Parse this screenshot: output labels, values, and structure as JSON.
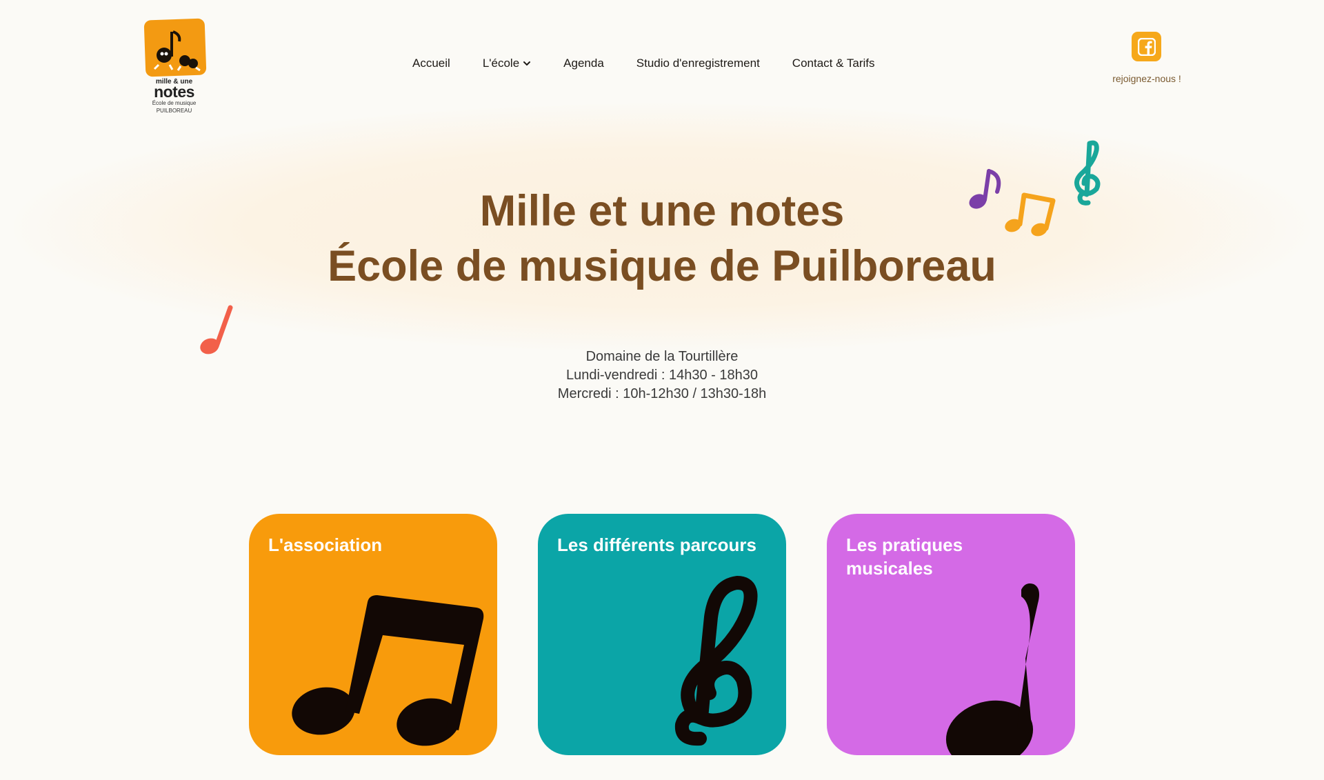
{
  "logo": {
    "line1": "mille & une",
    "line2": "notes",
    "line3": "École de musique",
    "line4": "PUILBOREAU",
    "color": "#f39a12"
  },
  "nav": {
    "items": [
      {
        "label": "Accueil"
      },
      {
        "label": "L'école",
        "has_dropdown": true
      },
      {
        "label": "Agenda"
      },
      {
        "label": "Studio d'enregistrement"
      },
      {
        "label": "Contact & Tarifs"
      }
    ]
  },
  "social": {
    "icon": "facebook-icon",
    "label": "rejoignez-nous !",
    "color": "#f6a81b"
  },
  "hero": {
    "title_line1": "Mille et une notes",
    "title_line2": "École de musique de Puilboreau",
    "title_color": "#7a4e22"
  },
  "info": {
    "line1": "Domaine de la Tourtillère",
    "line2": "Lundi-vendredi : 14h30 - 18h30",
    "line3": "Mercredi : 10h-12h30 / 13h30-18h"
  },
  "cards": [
    {
      "title": "L'association",
      "color": "#f89b0c",
      "icon": "beamed-notes-icon"
    },
    {
      "title": "Les différents parcours",
      "color": "#0ba5a7",
      "icon": "treble-clef-icon"
    },
    {
      "title": "Les pratiques musicales",
      "color": "#d46ae6",
      "icon": "quarter-note-icon"
    }
  ],
  "decorations": {
    "purple_note_color": "#7b3fa8",
    "orange_notes_color": "#f5a31c",
    "teal_clef_color": "#1aa79a",
    "red_note_color": "#f2604a"
  }
}
